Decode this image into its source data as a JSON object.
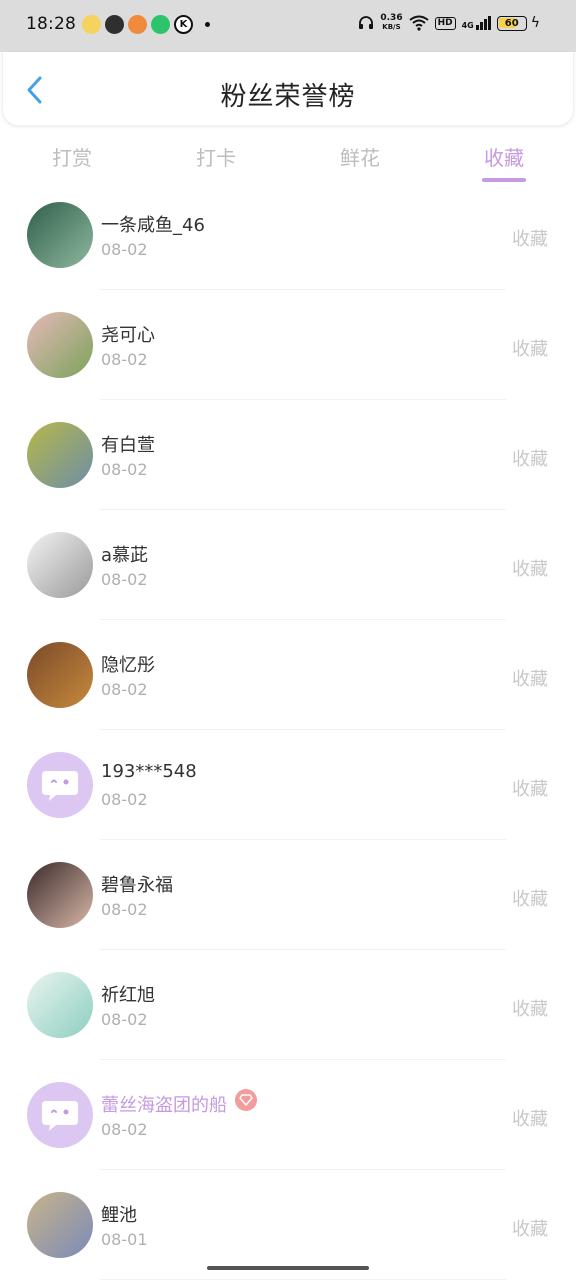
{
  "status_bar": {
    "time": "18:28",
    "net_speed_value": "0.36",
    "net_speed_unit": "KB/S",
    "battery_level": "60",
    "hd_label": "HD",
    "network_label": "4G"
  },
  "header": {
    "title": "粉丝荣誉榜",
    "back_icon": "chevron-left-icon"
  },
  "tabs": [
    {
      "label": "打赏",
      "active": false
    },
    {
      "label": "打卡",
      "active": false
    },
    {
      "label": "鲜花",
      "active": false
    },
    {
      "label": "收藏",
      "active": true
    }
  ],
  "fans": [
    {
      "name": "一条咸鱼_46",
      "date": "08-02",
      "action": "收藏",
      "avatar_colors": [
        "#2f5f4a",
        "#8fb8a0"
      ]
    },
    {
      "name": "尧可心",
      "date": "08-02",
      "action": "收藏",
      "avatar_colors": [
        "#e7b9b9",
        "#7aa35a"
      ]
    },
    {
      "name": "有白萱",
      "date": "08-02",
      "action": "收藏",
      "avatar_colors": [
        "#b7b84a",
        "#6c8ea6"
      ]
    },
    {
      "name": "a慕茈",
      "date": "08-02",
      "action": "收藏",
      "avatar_colors": [
        "#f3f3f3",
        "#9a9a9a"
      ]
    },
    {
      "name": "隐忆彤",
      "date": "08-02",
      "action": "收藏",
      "avatar_colors": [
        "#7a4a2a",
        "#c78a3c"
      ]
    },
    {
      "name": "193***548",
      "date": "08-02",
      "action": "收藏",
      "avatar_colors": null
    },
    {
      "name": "碧鲁永福",
      "date": "08-02",
      "action": "收藏",
      "avatar_colors": [
        "#3a2a2a",
        "#d8b8a8"
      ]
    },
    {
      "name": "祈红旭",
      "date": "08-02",
      "action": "收藏",
      "avatar_colors": [
        "#eaf4f0",
        "#8ccfc0"
      ]
    },
    {
      "name": "蕾丝海盗团的船",
      "date": "08-02",
      "action": "收藏",
      "avatar_colors": null,
      "vip": true
    },
    {
      "name": "鲤池",
      "date": "08-01",
      "action": "收藏",
      "avatar_colors": [
        "#c8b48a",
        "#7a8ab8"
      ]
    }
  ],
  "colors": {
    "accent": "#c59ae0",
    "muted": "#bdbdbd",
    "default_avatar_bg": "#dcc7f3",
    "vip_badge": "#f29c9c"
  }
}
